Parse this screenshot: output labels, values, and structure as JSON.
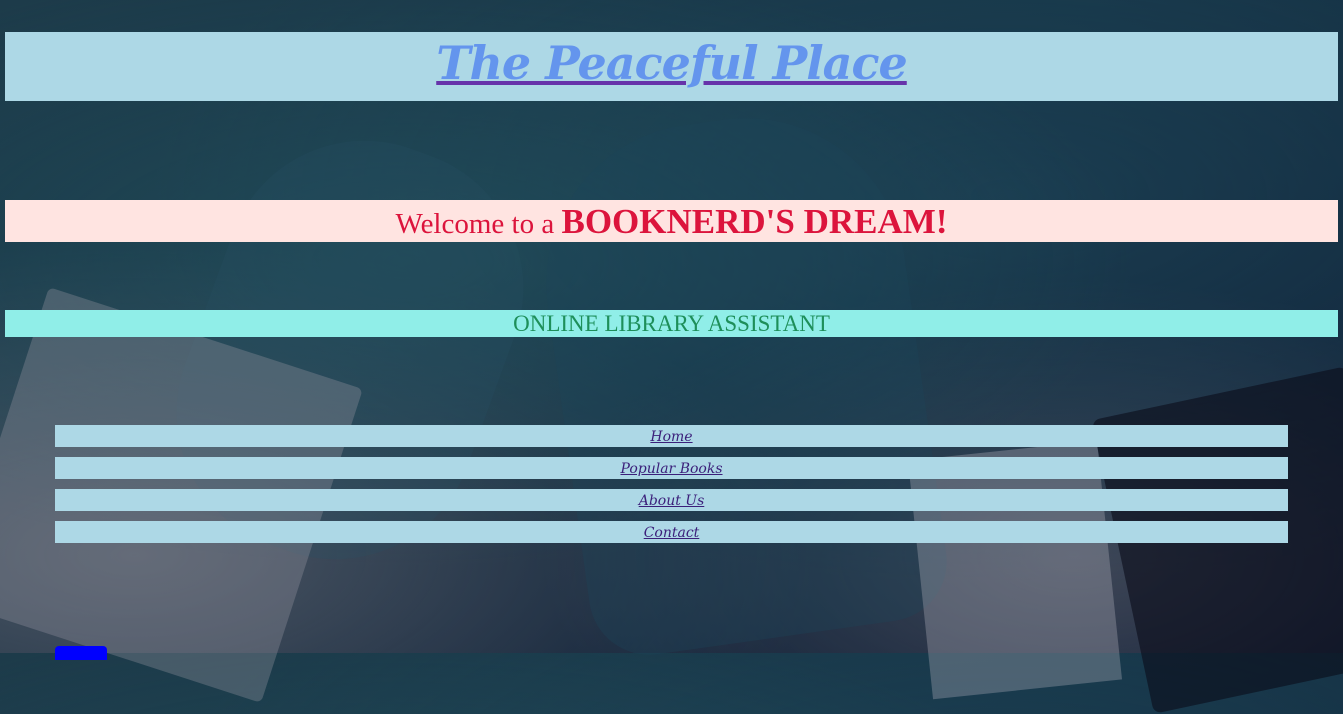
{
  "header": {
    "title": "The Peaceful Place"
  },
  "welcome": {
    "prefix": "Welcome to a ",
    "emphasis": "BOOKNERD'S DREAM!"
  },
  "assistant": {
    "label": "ONLINE LIBRARY ASSISTANT"
  },
  "nav": {
    "items": [
      {
        "label": "Home"
      },
      {
        "label": "Popular Books"
      },
      {
        "label": "About Us"
      },
      {
        "label": "Contact"
      }
    ]
  },
  "colors": {
    "title_bar": "#add8e6",
    "title_text": "#6495ed",
    "welcome_bar": "#ffe4e1",
    "welcome_text": "#dc143c",
    "assistant_bar": "#90eee8",
    "assistant_text": "#1e8f5a",
    "nav_bar": "#add8e6",
    "nav_text": "#3b1f7a",
    "button": "#0000ff"
  }
}
